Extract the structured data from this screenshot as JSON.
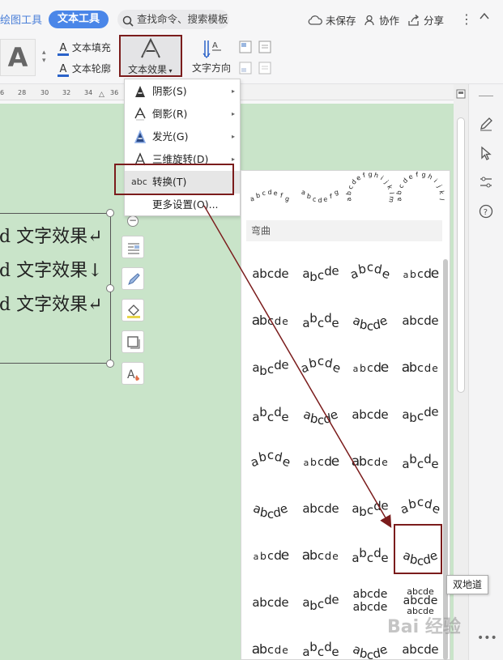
{
  "tabs": {
    "drawing_tools": "绘图工具",
    "text_tools": "文本工具"
  },
  "search": {
    "placeholder": "查找命令、搜索模板"
  },
  "topbar": {
    "unsaved": "未保存",
    "collaborate": "协作",
    "share": "分享"
  },
  "ribbon": {
    "text_fill": "文本填充",
    "text_outline": "文本轮廓",
    "text_effect": "文本效果",
    "text_direction": "文字方向",
    "big_a": "A"
  },
  "ruler": {
    "ticks": [
      "6",
      "28",
      "30",
      "32",
      "34",
      "36"
    ]
  },
  "document": {
    "lines": [
      "d 文字效果↵",
      "d 文字效果↓",
      "d 文字效果↵"
    ]
  },
  "menu": {
    "items": [
      {
        "label": "阴影(S)",
        "icon": "shadow-a-icon",
        "submenu": true
      },
      {
        "label": "倒影(R)",
        "icon": "reflection-a-icon",
        "submenu": true
      },
      {
        "label": "发光(G)",
        "icon": "glow-a-icon",
        "submenu": true
      },
      {
        "label": "三维旋转(D)",
        "icon": "3d-rotate-a-icon",
        "submenu": true
      },
      {
        "label": "转换(T)",
        "icon": "abc-transform-icon",
        "submenu": false
      },
      {
        "label": "更多设置(O)...",
        "icon": "",
        "submenu": false
      }
    ]
  },
  "gallery": {
    "section": "弯曲",
    "sample": "abcde",
    "top_samples": [
      "abcdefg",
      "abcdefg",
      "abcdefghijklm",
      "abcdefghijkl"
    ],
    "grid_rows": 9,
    "grid_cols": 4
  },
  "tooltip": "双地道",
  "watermark": "Bai 经验",
  "colors": {
    "accent": "#4a86e8",
    "highlight": "#7b1c1c",
    "doc_bg": "#c9e4c9"
  }
}
